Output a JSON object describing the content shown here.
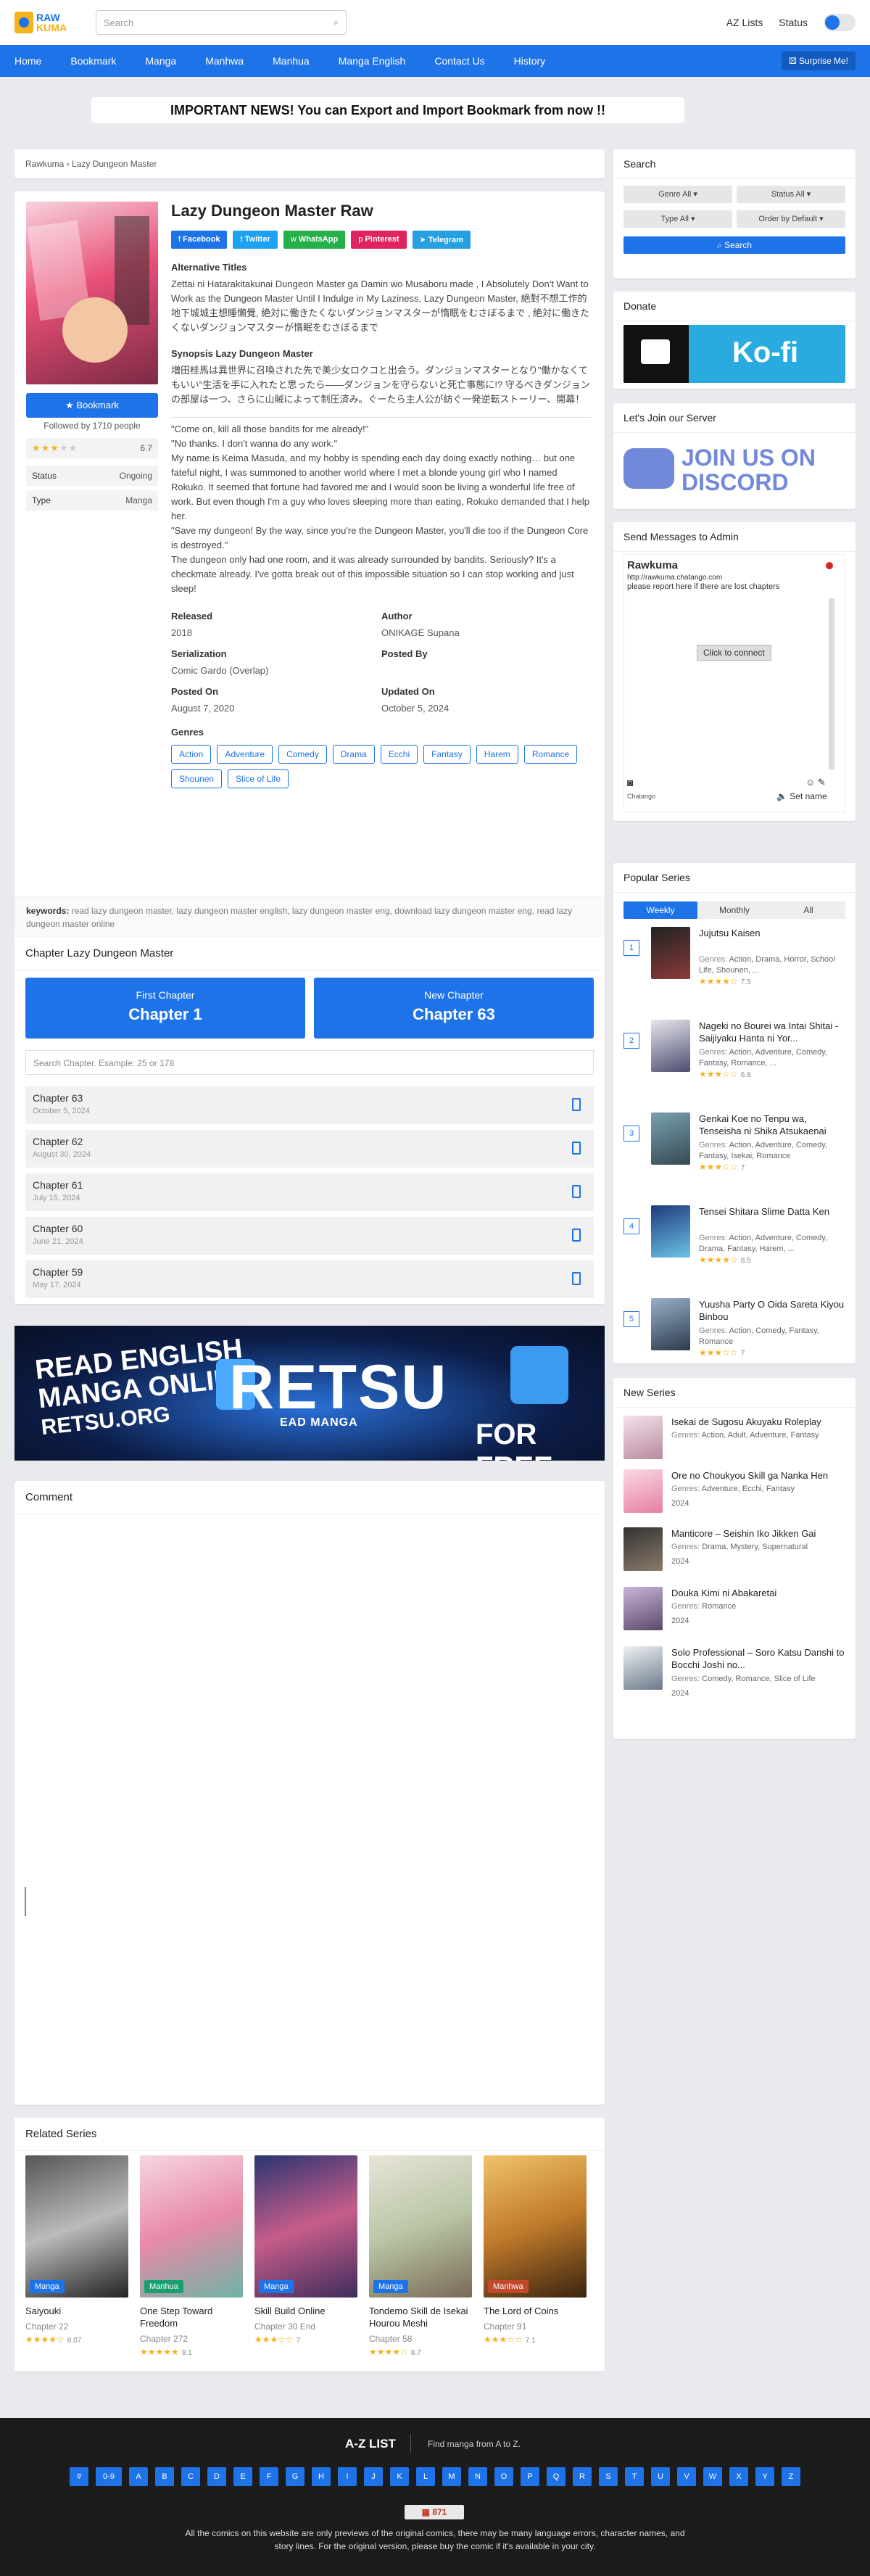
{
  "header": {
    "logo_top": "RAW",
    "logo_bottom": "KUMA",
    "search_placeholder": "Search",
    "az_lists": "AZ Lists",
    "status": "Status"
  },
  "nav": {
    "items": [
      "Home",
      "Bookmark",
      "Manga",
      "Manhwa",
      "Manhua",
      "Manga English",
      "Contact Us",
      "History"
    ],
    "surprise": "Surprise Me!"
  },
  "notice": "IMPORTANT NEWS! You can Export and Import Bookmark from now !!",
  "breadcrumb": "Rawkuma › Lazy Dungeon Master",
  "series": {
    "title": "Lazy Dungeon Master Raw",
    "bookmark": "Bookmark",
    "followed": "Followed by 1710 people",
    "rating": "6.7",
    "status_label": "Status",
    "status_value": "Ongoing",
    "type_label": "Type",
    "type_value": "Manga",
    "share": [
      "Facebook",
      "Twitter",
      "WhatsApp",
      "Pinterest",
      "Telegram"
    ],
    "alt_title_h": "Alternative Titles",
    "alt_titles": "Zettai ni Hatarakitakunai Dungeon Master ga Damin wo Musaboru made , I Absolutely Don't Want to Work as the Dungeon Master Until I Indulge in My Laziness, Lazy Dungeon Master, 絶對不想工作的地下城城主想睡懶覺, 絶対に働きたくないダンジョンマスターが惰眠をむさぼるまで , 絶対に働きたくないダンジョンマスターが惰眠をむさぼるまで",
    "synopsis_h": "Synopsis Lazy Dungeon Master",
    "synopsis_jp": "増田桂馬は異世界に召喚された先で美少女ロクコと出会う。ダンジョンマスターとなり\"働かなくてもいい\"生活を手に入れたと思ったら――ダンジョンを守らないと死亡事態に!? 守るべきダンジョンの部屋は一つ、さらに山賊によって制圧済み。ぐーたら主人公が紡ぐ一発逆転ストーリー、開幕！",
    "synopsis_en": [
      "\"Come on, kill all those bandits for me already!\"",
      "\"No thanks. I don't wanna do any work.\"",
      "My name is Keima Masuda, and my hobby is spending each day doing exactly nothing… but one fateful night, I was summoned to another world where I met a blonde young girl who I named Rokuko. It seemed that fortune had favored me and I would soon be living a wonderful life free of work. But even though I'm a guy who loves sleeping more than eating, Rokuko demanded that I help her.",
      "\"Save my dungeon! By the way, since you're the Dungeon Master, you'll die too if the Dungeon Core is destroyed.\"",
      "The dungeon only had one room, and it was already surrounded by bandits. Seriously? It's a checkmate already. I've gotta break out of this impossible situation so I can stop working and just sleep!"
    ],
    "released_l": "Released",
    "released": "2018",
    "author_l": "Author",
    "author": "ONIKAGE Supana",
    "serial_l": "Serialization",
    "serial": "Comic Gardo (Overlap)",
    "postedby_l": "Posted By",
    "postedby": "",
    "postedon_l": "Posted On",
    "postedon": "August 7, 2020",
    "updated_l": "Updated On",
    "updated": "October 5, 2024",
    "genres_h": "Genres",
    "genres": [
      "Action",
      "Adventure",
      "Comedy",
      "Drama",
      "Ecchi",
      "Fantasy",
      "Harem",
      "Romance",
      "Shounen",
      "Slice of Life"
    ],
    "keywords_l": "keywords:",
    "keywords": "read lazy dungeon master, lazy dungeon master english, lazy dungeon master eng, download lazy dungeon master eng, read lazy dungeon master online"
  },
  "chapters": {
    "heading": "Chapter Lazy Dungeon Master",
    "first_l": "First Chapter",
    "first": "Chapter 1",
    "new_l": "New Chapter",
    "new": "Chapter 63",
    "search": "Search Chapter. Example: 25 or 178",
    "list": [
      {
        "t": "Chapter 63",
        "d": "October 5, 2024"
      },
      {
        "t": "Chapter 62",
        "d": "August 30, 2024"
      },
      {
        "t": "Chapter 61",
        "d": "July 15, 2024"
      },
      {
        "t": "Chapter 60",
        "d": "June 21, 2024"
      },
      {
        "t": "Chapter 59",
        "d": "May 17, 2024"
      }
    ]
  },
  "banner": {
    "left1": "READ ENGLISH",
    "left2": "MANGA ONLINE",
    "left3": "RETSU.ORG",
    "brand": "RETSU",
    "brand_sub": "EAD MANGA",
    "right": "FOR FREE"
  },
  "comment_h": "Comment",
  "related": {
    "heading": "Related Series",
    "items": [
      {
        "name": "Saiyouki",
        "type": "Manga",
        "chapter": "Chapter 22",
        "rating": "8.07",
        "color": "#1e73e8"
      },
      {
        "name": "One Step Toward Freedom",
        "type": "Manhua",
        "chapter": "Chapter 272",
        "rating": "9.1",
        "color": "#1aa070"
      },
      {
        "name": "Skill Build Online",
        "type": "Manga",
        "chapter": "Chapter 30 End",
        "rating": "7",
        "color": "#1e73e8"
      },
      {
        "name": "Tondemo Skill de Isekai Hourou Meshi",
        "type": "Manga",
        "chapter": "Chapter 58",
        "rating": "8.7",
        "color": "#1e73e8"
      },
      {
        "name": "The Lord of Coins",
        "type": "Manhwa",
        "chapter": "Chapter 91",
        "rating": "7.1",
        "color": "#c0492b"
      }
    ]
  },
  "sidebar": {
    "search_h": "Search",
    "selects": [
      "Genre All",
      "Status All",
      "Type All",
      "Order by Default"
    ],
    "search_btn": "Search",
    "donate_h": "Donate",
    "kofi": "Ko-fi",
    "server_h": "Let's Join our Server",
    "discord": "JOIN US ON DISCORD",
    "admin_h": "Send Messages to Admin",
    "chat_name": "Rawkuma",
    "chat_url": "http://rawkuma.chatango.com",
    "chat_msg": "please report here if there are lost chapters",
    "chat_connect": "Click to connect",
    "chat_brand": "Chatango",
    "chat_setname": "Set name",
    "popular_h": "Popular Series",
    "tabs": [
      "Weekly",
      "Monthly",
      "All"
    ],
    "genres_label": "Genres:",
    "popular": [
      {
        "n": "1",
        "t": "Jujutsu Kaisen",
        "g": "Action, Drama, Horror, School Life, Shounen, ...",
        "r": "7.5"
      },
      {
        "n": "2",
        "t": "Nageki no Bourei wa Intai Shitai - Saijiyaku Hanta ni Yor...",
        "g": "Action, Adventure, Comedy, Fantasy, Romance, ...",
        "r": "6.8"
      },
      {
        "n": "3",
        "t": "Genkai Koe no Tenpu wa, Tenseisha ni Shika Atsukaenai",
        "g": "Action, Adventure, Comedy, Fantasy, Isekai, Romance",
        "r": "7"
      },
      {
        "n": "4",
        "t": "Tensei Shitara Slime Datta Ken",
        "g": "Action, Adventure, Comedy, Drama, Fantasy, Harem, ...",
        "r": "8.5"
      },
      {
        "n": "5",
        "t": "Yuusha Party O Oida Sareta Kiyou Binbou",
        "g": "Action, Comedy, Fantasy, Romance",
        "r": "7"
      }
    ],
    "new_h": "New Series",
    "new": [
      {
        "t": "Isekai de Sugosu Akuyaku Roleplay",
        "g": "Action, Adult, Adventure, Fantasy",
        "y": ""
      },
      {
        "t": "Ore no Choukyou Skill ga Nanka Hen",
        "g": "Adventure, Ecchi, Fantasy",
        "y": "2024"
      },
      {
        "t": "Manticore – Seishin Iko Jikken Gai",
        "g": "Drama, Mystery, Supernatural",
        "y": "2024"
      },
      {
        "t": "Douka Kimi ni Abakaretai",
        "g": "Romance",
        "y": "2024"
      },
      {
        "t": "Solo Professional – Soro Katsu Danshi to Bocchi Joshi no...",
        "g": "Comedy, Romance, Slice of Life",
        "y": "2024"
      }
    ]
  },
  "footer": {
    "az_h": "A-Z LIST",
    "az_sub": "Find manga from A to Z.",
    "letters": [
      "#",
      "0-9",
      "A",
      "B",
      "C",
      "D",
      "E",
      "F",
      "G",
      "H",
      "I",
      "J",
      "K",
      "L",
      "M",
      "N",
      "O",
      "P",
      "Q",
      "R",
      "S",
      "T",
      "U",
      "V",
      "W",
      "X",
      "Y",
      "Z"
    ],
    "counter": "871",
    "disclaimer": "All the comics on this website are only previews of the original comics, there may be many language errors, character names, and story lines. For the original version, please buy the comic if it's available in your city."
  }
}
